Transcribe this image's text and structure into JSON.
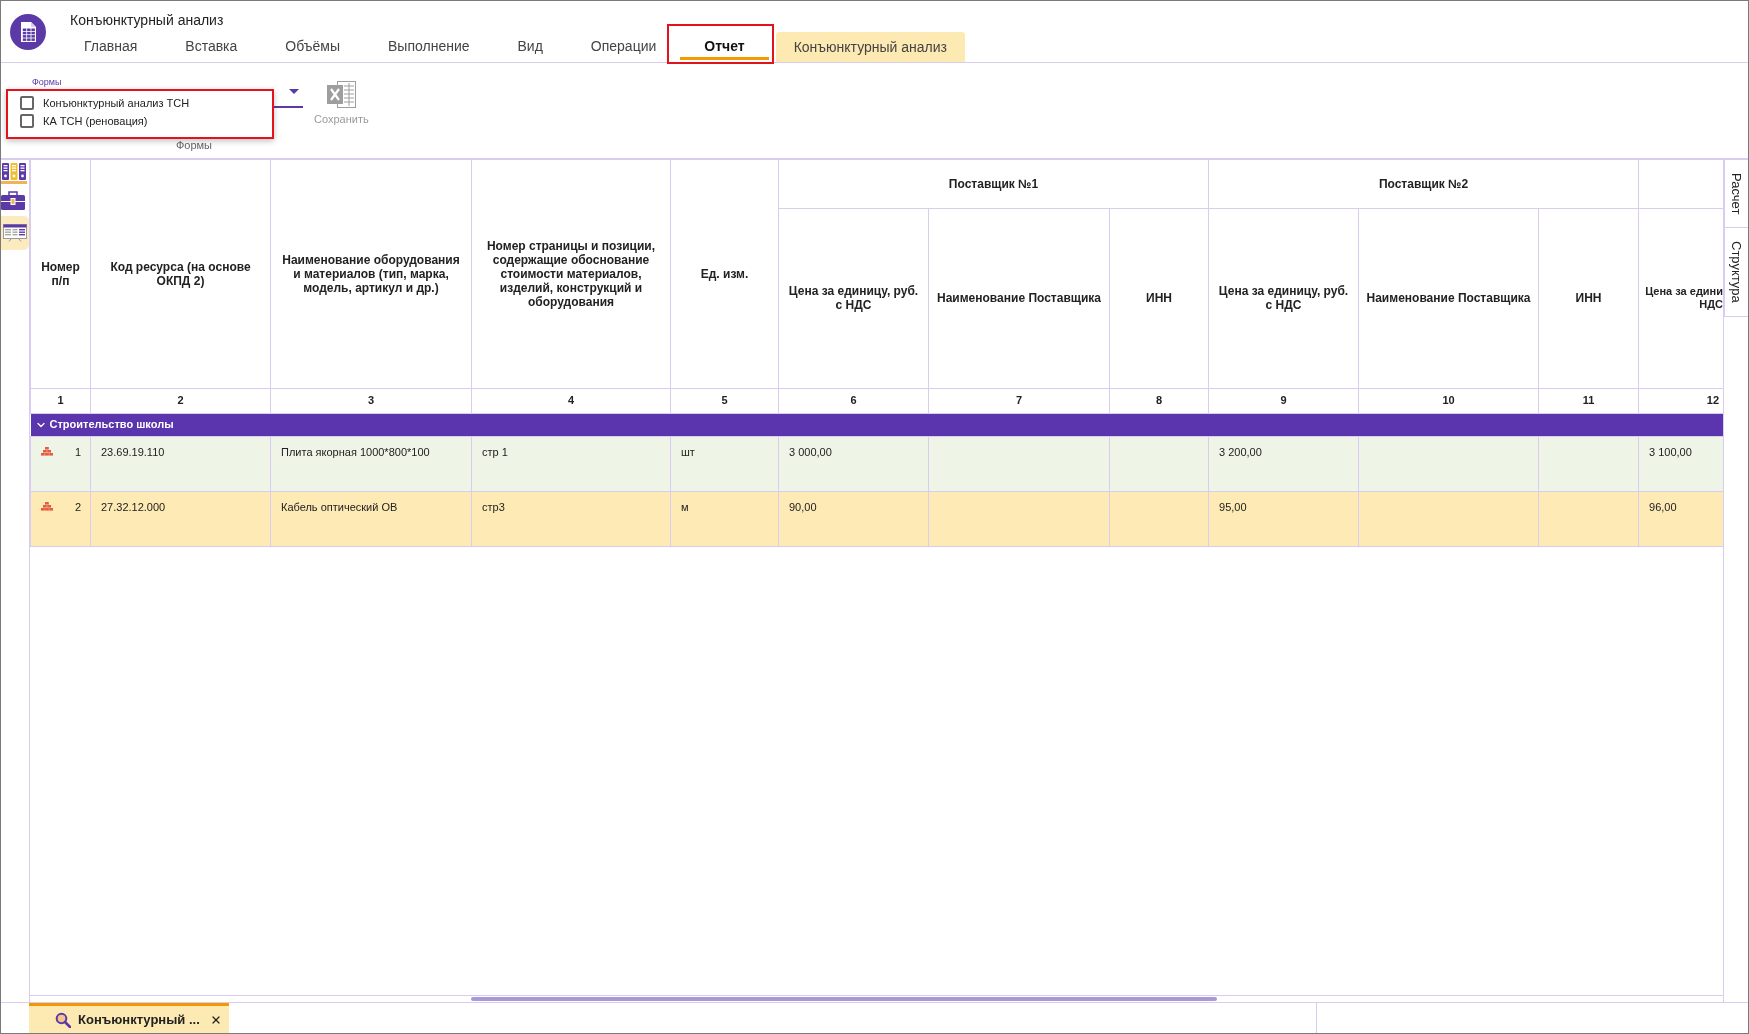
{
  "window": {
    "title": "Конъюнктурный анализ"
  },
  "ribbon_tabs": [
    {
      "label": "Главная",
      "selected": false,
      "contextual": false,
      "annotated": false
    },
    {
      "label": "Вставка",
      "selected": false,
      "contextual": false,
      "annotated": false
    },
    {
      "label": "Объёмы",
      "selected": false,
      "contextual": false,
      "annotated": false
    },
    {
      "label": "Выполнение",
      "selected": false,
      "contextual": false,
      "annotated": false
    },
    {
      "label": "Вид",
      "selected": false,
      "contextual": false,
      "annotated": false
    },
    {
      "label": "Операции",
      "selected": false,
      "contextual": false,
      "annotated": false
    },
    {
      "label": "Отчет",
      "selected": true,
      "contextual": false,
      "annotated": true
    },
    {
      "label": "Конъюнктурный анализ",
      "selected": false,
      "contextual": true,
      "annotated": false
    }
  ],
  "ribbon": {
    "forms_field": {
      "label": "Формы",
      "expanded": true,
      "annotated": true,
      "options": [
        {
          "label": "Конъюнктурный анализ ТСН",
          "checked": false
        },
        {
          "label": "КА ТСН (реновация)",
          "checked": false
        }
      ]
    },
    "save_button": {
      "label": "Сохранить",
      "disabled": true
    },
    "group_label": "Формы"
  },
  "left_toolbar": [
    {
      "kind": "binders",
      "selected": false
    },
    {
      "kind": "briefcase",
      "selected": false
    },
    {
      "kind": "table",
      "selected": true
    }
  ],
  "table": {
    "fixed_columns": [
      {
        "kind": "number",
        "label": "Номер п/п",
        "number": "1"
      },
      {
        "kind": "code",
        "label": "Код ресурса (на основе ОКПД 2)",
        "number": "2"
      },
      {
        "kind": "name",
        "label": "Наименование оборудования и материалов (тип, марка, модель, артикул и др.)",
        "number": "3"
      },
      {
        "kind": "page",
        "label": "Номер страницы и позиции, содержащие обоснование стоимости материалов, изделий, конструкций и оборудования",
        "number": "4"
      },
      {
        "kind": "unit",
        "label": "Ед. изм.",
        "number": "5"
      }
    ],
    "supplier_groups": [
      {
        "title": "Поставщик №1",
        "columns": [
          {
            "kind": "price",
            "label": "Цена за единицу, руб. с НДС",
            "number": "6"
          },
          {
            "kind": "supplier",
            "label": "Наименование Поставщика",
            "number": "7"
          },
          {
            "kind": "inn",
            "label": "ИНН",
            "number": "8"
          }
        ]
      },
      {
        "title": "Поставщик №2",
        "columns": [
          {
            "kind": "price",
            "label": "Цена за единицу, руб. с НДС",
            "number": "9"
          },
          {
            "kind": "supplier",
            "label": "Наименование Поставщика",
            "number": "10"
          },
          {
            "kind": "inn",
            "label": "ИНН",
            "number": "11"
          }
        ]
      },
      {
        "columns": [
          {
            "kind": "price",
            "lines": [
              "Цена за едини",
              "НДС"
            ],
            "number": "12"
          }
        ]
      }
    ],
    "groups": [
      {
        "title": "Строительство школы",
        "expanded": true,
        "rows": [
          {
            "number": "1",
            "code": "23.69.19.110",
            "name": "Плита якорная 1000*800*100",
            "page": "стр 1",
            "unit": "шт",
            "color": "#eef5e6",
            "offers": [
              {
                "price": "3 000,00"
              },
              {
                "price": "3 200,00"
              },
              {
                "price": "3 100,00"
              }
            ]
          },
          {
            "number": "2",
            "code": "27.32.12.000",
            "name": "Кабель оптический ОВ",
            "page": "стр3",
            "unit": "м",
            "color": "#fdeab4",
            "offers": [
              {
                "price": "90,00"
              },
              {
                "price": "95,00"
              },
              {
                "price": "96,00"
              }
            ]
          }
        ]
      }
    ]
  },
  "side_tabs": [
    {
      "label": "Расчет"
    },
    {
      "label": "Структура"
    }
  ],
  "bottom_tabs": [
    {
      "label": "Конъюнктурный ...",
      "selected": true
    }
  ]
}
